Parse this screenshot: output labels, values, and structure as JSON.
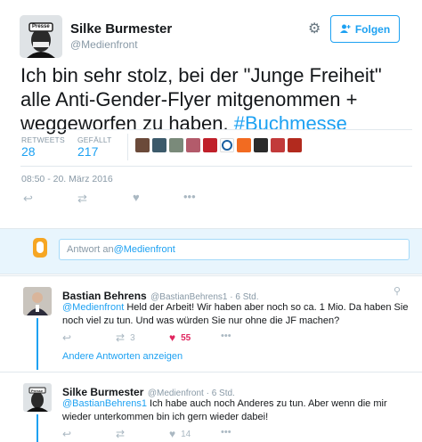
{
  "tweet": {
    "author_name": "Silke Burmester",
    "author_handle": "@Medienfront",
    "follow_label": "Folgen",
    "text_main": "Ich bin sehr stolz, bei der \"Junge Freiheit\" alle Anti-Gender-Flyer mitgenommen + weggeworfen zu haben. ",
    "hashtag": "#Buchmesse",
    "retweets_label": "RETWEETS",
    "retweets_value": "28",
    "likes_label": "GEFÄLLT",
    "likes_value": "217",
    "timestamp": "08:50 - 20. März 2016",
    "avatar_caption": "Presse"
  },
  "reply_box": {
    "placeholder_prefix": "Antwort an ",
    "placeholder_mention": "@Medienfront"
  },
  "replies": [
    {
      "name": "Bastian Behrens",
      "meta": "@BastianBehrens1 · 6 Std.",
      "mention": "@Medienfront",
      "text": " Held der Arbeit! Wir haben aber noch so ca. 1 Mio. Da haben Sie noch viel zu tun. Und was würden Sie nur ohne die JF machen?",
      "retweets": "3",
      "likes": "55"
    },
    {
      "name": "Silke Burmester",
      "meta": "@Medienfront · 6 Std.",
      "mention": "@BastianBehrens1",
      "text": " Ich habe auch noch Anderes zu tun. Aber wenn die mir wieder unterkommen bin ich gern wieder dabei!",
      "likes": "14",
      "avatar_caption": "Presse"
    }
  ],
  "more_replies_label": "Andere Antworten anzeigen",
  "colors": {
    "accent": "#1da1f2",
    "like": "#e0245e",
    "muted": "#8899a6"
  }
}
